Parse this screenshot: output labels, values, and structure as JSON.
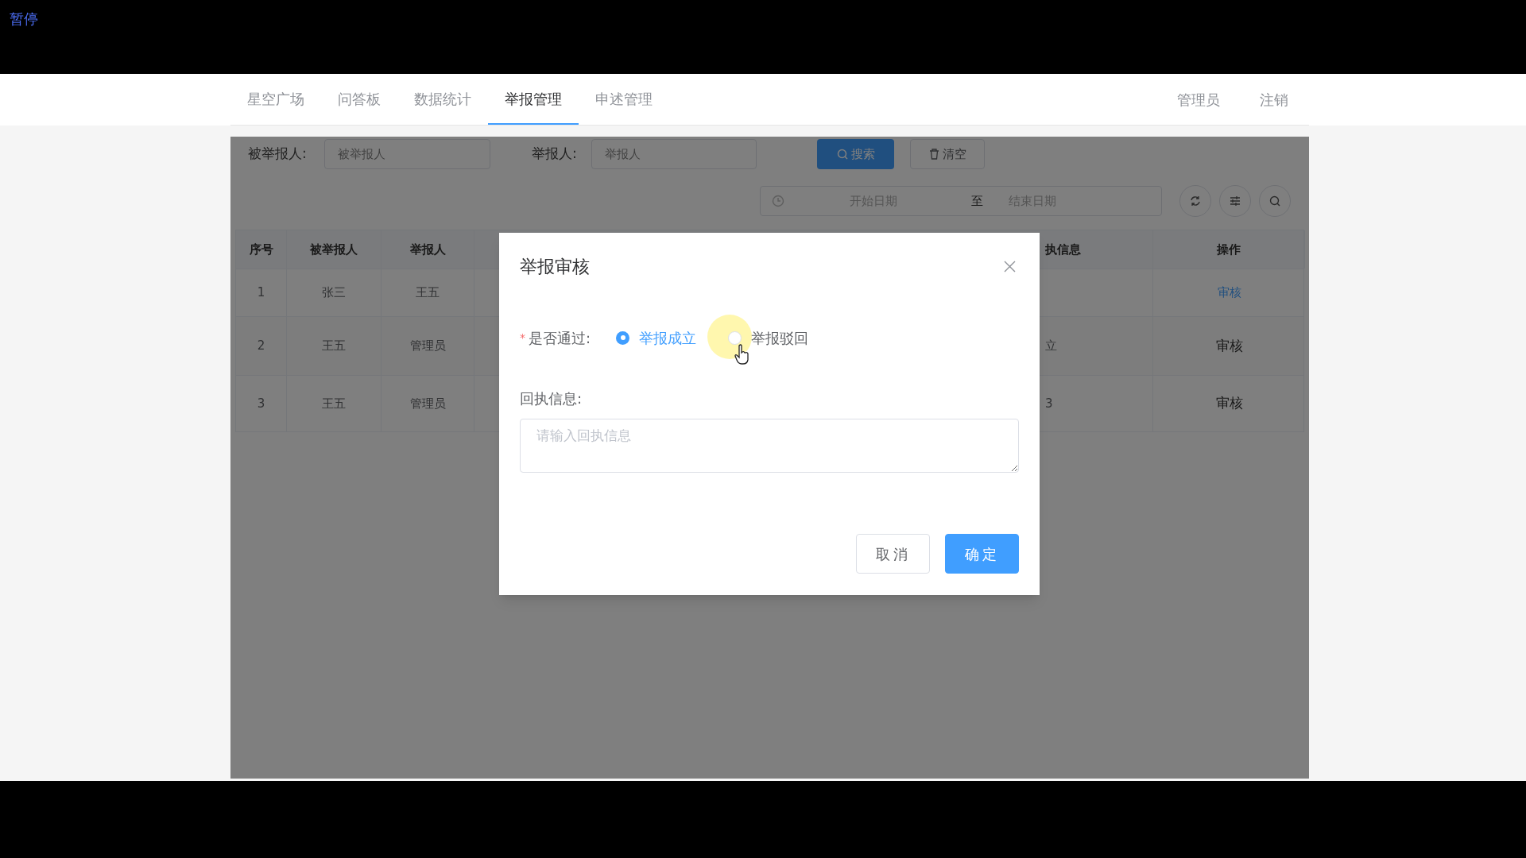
{
  "player_label": "暂停",
  "nav": {
    "items": [
      {
        "label": "星空广场",
        "selected": false
      },
      {
        "label": "问答板",
        "selected": false
      },
      {
        "label": "数据统计",
        "selected": false
      },
      {
        "label": "举报管理",
        "selected": true
      },
      {
        "label": "申述管理",
        "selected": false
      }
    ],
    "right": [
      "管理员",
      "注销"
    ]
  },
  "filters": {
    "reported_label": "被举报人:",
    "reported_placeholder": "被举报人",
    "reporter_label": "举报人:",
    "reporter_placeholder": "举报人",
    "search_button": "搜索",
    "clear_button": "清空",
    "start_placeholder": "开始日期",
    "range_separator": "至",
    "end_placeholder": "结束日期"
  },
  "table": {
    "columns": [
      "序号",
      "被举报人",
      "举报人",
      "执信息",
      "操作"
    ],
    "rows": [
      {
        "cells": [
          "1",
          "张三",
          "王五",
          ""
        ],
        "action": "审核",
        "disabled": false
      },
      {
        "cells": [
          "2",
          "王五",
          "管理员",
          "立"
        ],
        "action": "审核",
        "disabled": true
      },
      {
        "cells": [
          "3",
          "王五",
          "管理员",
          "3"
        ],
        "action": "审核",
        "disabled": true
      }
    ]
  },
  "dialog": {
    "title": "举报审核",
    "pass_label": "是否通过:",
    "required_mark": "*",
    "options": [
      {
        "label": "举报成立",
        "selected": true
      },
      {
        "label": "举报驳回",
        "selected": false
      }
    ],
    "receipt_label": "回执信息:",
    "receipt_placeholder": "请输入回执信息",
    "buttons": [
      {
        "label": "取消",
        "kind": "default"
      },
      {
        "label": "确定",
        "kind": "primary"
      }
    ]
  }
}
